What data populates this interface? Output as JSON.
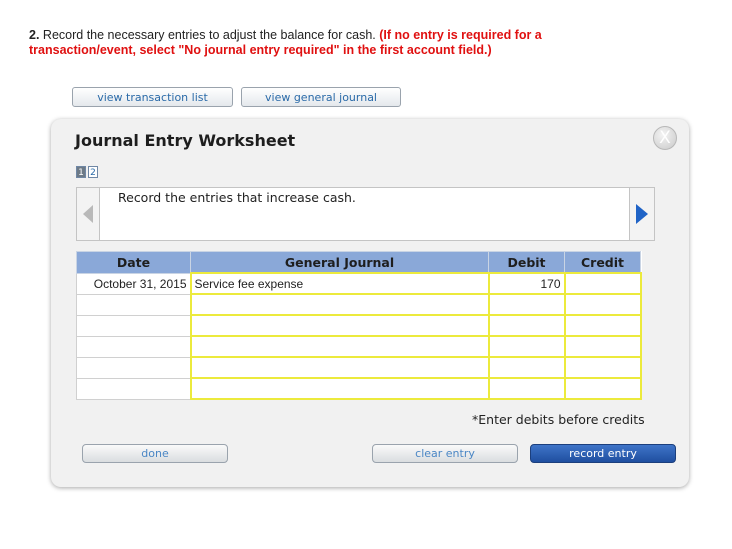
{
  "question": {
    "number": "2.",
    "text": "Record the necessary entries to adjust the balance for cash.",
    "instruction": "(If no entry is required for a transaction/event, select \"No journal entry required\" in the first account field.)"
  },
  "toolbar": {
    "view_transaction_list": "view transaction list",
    "view_general_journal": "view general journal"
  },
  "worksheet": {
    "title": "Journal Entry Worksheet",
    "close_glyph": "X",
    "pages": [
      "1",
      "2"
    ],
    "current_page": "1",
    "instruction_text": "Record the entries that increase cash.",
    "columns": {
      "date": "Date",
      "general_journal": "General Journal",
      "debit": "Debit",
      "credit": "Credit"
    },
    "rows": [
      {
        "date": "October 31, 2015",
        "account": "Service fee expense",
        "debit": "170",
        "credit": ""
      },
      {
        "date": "",
        "account": "",
        "debit": "",
        "credit": ""
      },
      {
        "date": "",
        "account": "",
        "debit": "",
        "credit": ""
      },
      {
        "date": "",
        "account": "",
        "debit": "",
        "credit": ""
      },
      {
        "date": "",
        "account": "",
        "debit": "",
        "credit": ""
      },
      {
        "date": "",
        "account": "",
        "debit": "",
        "credit": ""
      }
    ],
    "note": "*Enter debits before credits",
    "buttons": {
      "done": "done",
      "clear_entry": "clear entry",
      "record_entry": "record entry"
    }
  },
  "colors": {
    "header_blue": "#8aa8d8",
    "input_yellow": "#ecea3c",
    "question_red": "#e01010",
    "link_blue": "#2a6aa8",
    "record_button": "#2a5db0"
  },
  "icons": {
    "close": "close-icon",
    "prev": "arrow-left-icon",
    "next": "arrow-right-icon"
  }
}
